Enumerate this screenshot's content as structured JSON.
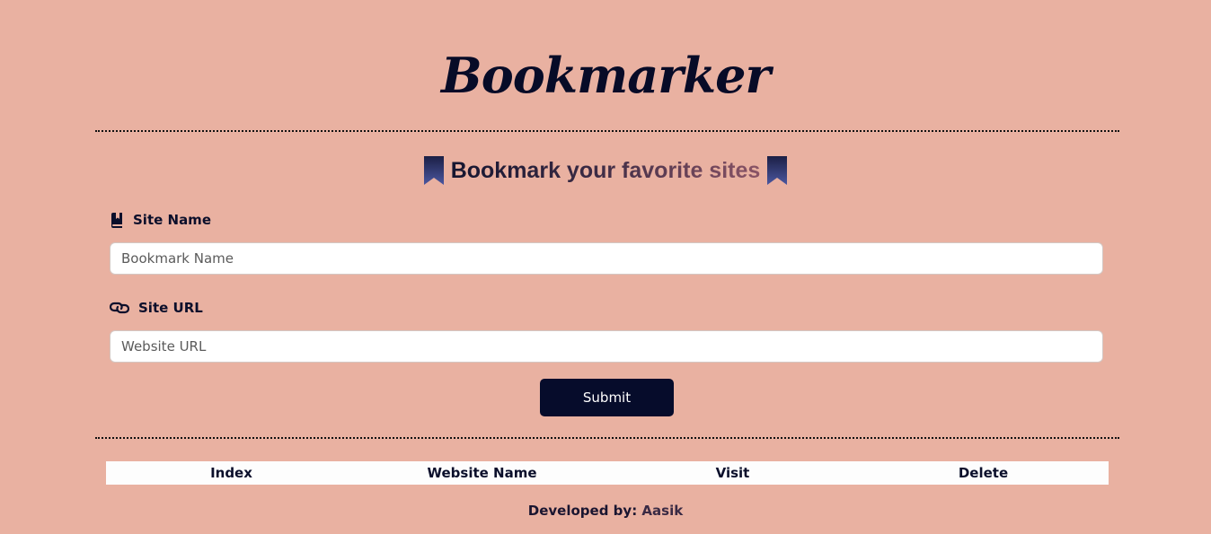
{
  "header": {
    "title": "Bookmarker"
  },
  "subtitle": {
    "part1": "Bookmark your",
    "part2": "favorite sites",
    "icon": "bookmark-ribbon-icon"
  },
  "form": {
    "site_name": {
      "label": "Site Name",
      "icon": "book-icon",
      "placeholder": "Bookmark Name",
      "value": ""
    },
    "site_url": {
      "label": "Site URL",
      "icon": "link-icon",
      "placeholder": "Website URL",
      "value": ""
    },
    "submit_label": "Submit"
  },
  "table": {
    "columns": [
      "Index",
      "Website Name",
      "Visit",
      "Delete"
    ],
    "rows": []
  },
  "footer": {
    "prefix": "Developed by:",
    "author": "Aasik"
  },
  "colors": {
    "background": "#e9b1a1",
    "primary": "#060c2b",
    "ribbon_top": "#1b1f45",
    "ribbon_bottom": "#4b57a0"
  }
}
